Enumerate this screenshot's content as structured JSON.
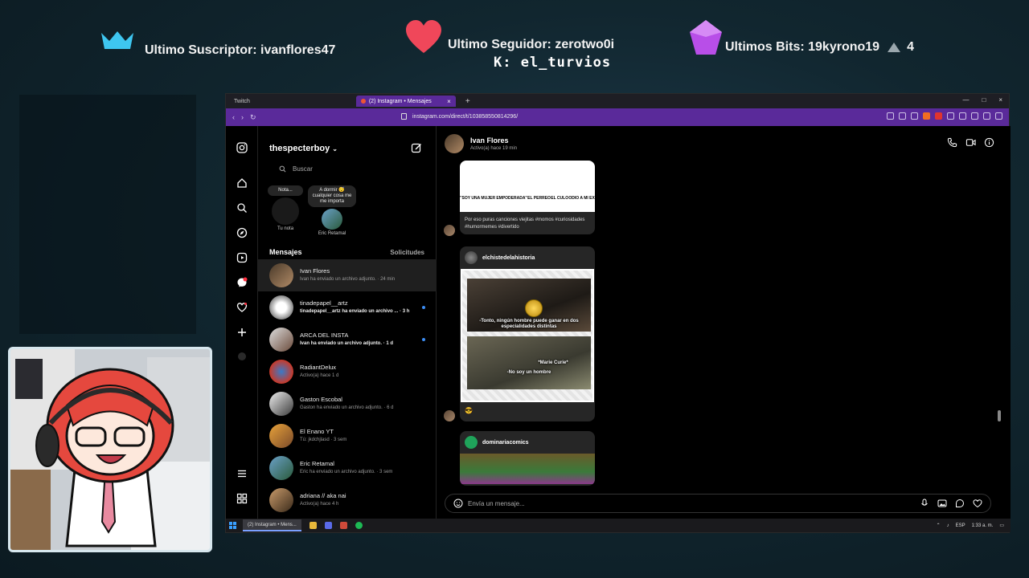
{
  "overlay": {
    "subscriber": "Ultimo Suscriptor: ivanflores47",
    "follower": "Ultimo Seguidor: zerotwo0i",
    "kick": "K: el_turvios",
    "bits": "Ultimos Bits: 19kyrono19",
    "bits_count": "4",
    "colors": {
      "crown": "#3ec6f0",
      "heart": "#f0475a",
      "gem": "#b84ee8"
    }
  },
  "browser": {
    "tabs": [
      {
        "label": "Twitch"
      },
      {
        "label": "(2) Instagram • Mensajes"
      }
    ],
    "new_tab": "+",
    "url": "instagram.com/direct/t/103858550814296/",
    "accent": "#5a2a9a"
  },
  "dm": {
    "account": "thespecterboy",
    "search_placeholder": "Buscar",
    "notes": [
      {
        "bubble": "Nota...",
        "label": "Tu nota"
      },
      {
        "bubble": "A dormir 😴 cualquier cosa me me importa",
        "label": "Eric Retamal"
      }
    ],
    "section_title": "Mensajes",
    "requests": "Solicitudes",
    "conversations": [
      {
        "name": "Ivan Flores",
        "preview": "Ivan ha enviado un archivo adjunto. · 24 min",
        "selected": true,
        "unread": false
      },
      {
        "name": "tinadepapel__artz",
        "preview": "tinadepapel__artz ha enviado un archivo ... · 3 h",
        "selected": false,
        "unread": true
      },
      {
        "name": "ARCA DEL INSTA",
        "preview": "Ivan ha enviado un archivo adjunto. · 1 d",
        "selected": false,
        "unread": true
      },
      {
        "name": "RadiantDelux",
        "preview": "Activo(a) hace 1 d",
        "selected": false,
        "unread": false
      },
      {
        "name": "Gaston Escobal",
        "preview": "Gaston ha enviado un archivo adjunto. · 6 d",
        "selected": false,
        "unread": false
      },
      {
        "name": "El Enano YT",
        "preview": "Tú: jkdchjlasd · 3 sem",
        "selected": false,
        "unread": false
      },
      {
        "name": "Eric Retamal",
        "preview": "Eric ha enviado un archivo adjunto. · 3 sem",
        "selected": false,
        "unread": false
      },
      {
        "name": "adriana // aka nai",
        "preview": "Activo(a) hace 4 h",
        "selected": false,
        "unread": false
      }
    ]
  },
  "chat": {
    "name": "Ivan Flores",
    "status": "Activo(a) hace 19 min",
    "meme1_labels": [
      "\"SOY UNA MUJER EMPODERADA\"",
      "EL PERREO",
      "EL CULO",
      "ODIO A MI EX"
    ],
    "caption": "Por eso puras canciones viejitas #momos #curiosidades #humormemes #divertido",
    "post1_account": "elchistedelahistoria",
    "meme2_top": "-Tonto, ningún hombre puede ganar en dos especialidades distintas",
    "meme2_name": "*Marie Curie*",
    "meme2_bottom": "-No soy un hombre",
    "reaction": "😎",
    "post2_account": "dominariacomics",
    "composer_placeholder": "Envía un mensaje..."
  },
  "taskbar": {
    "active_app": "(2) Instagram • Mens...",
    "lang": "ESP",
    "time": "1:33 a. m."
  }
}
